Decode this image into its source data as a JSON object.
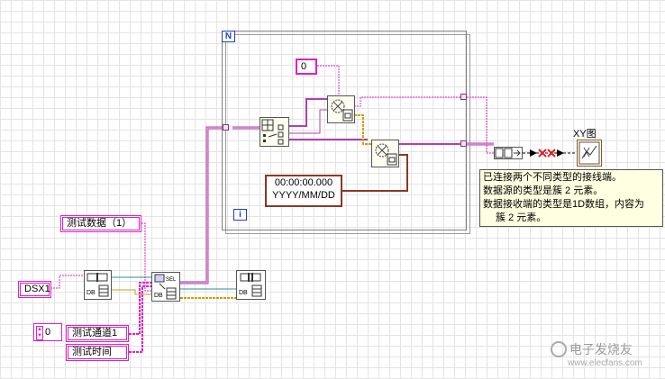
{
  "loop": {
    "label": "N",
    "iteration_label": "i"
  },
  "constants": {
    "zero": "0",
    "timestamp_line1": "00:00:00.000",
    "timestamp_line2": "YYYY/MM/DD"
  },
  "controls": {
    "test_data": "测试数据（1）",
    "dsx1": "DSX1",
    "numeric_value": "0",
    "test_channel": "测试通道1",
    "test_time": "测试时间"
  },
  "indicator": {
    "xy_graph": "XY图"
  },
  "error_tooltip": {
    "line1": "已连接两个不同类型的接线端。",
    "line2": "数据源的类型是簇 2 元素。",
    "line3": "数据接收端的类型是1D数组，内容为",
    "line4": "簇 2 元素。"
  },
  "watermark": {
    "line1": "电子发烧友",
    "line2": "www.elecfans.com"
  },
  "node_labels": {
    "db": "DB",
    "sel": "SEL"
  },
  "colors": {
    "wire_cluster": "#b040b0",
    "wire_string": "#e020c8",
    "wire_timestamp": "#8a3a22",
    "wire_error": "#c8a000",
    "wire_ref": "#2a9090",
    "loop_label": "#1f3fbf",
    "broken_wire": "#e02020",
    "tooltip_bg": "#ffffe1"
  }
}
